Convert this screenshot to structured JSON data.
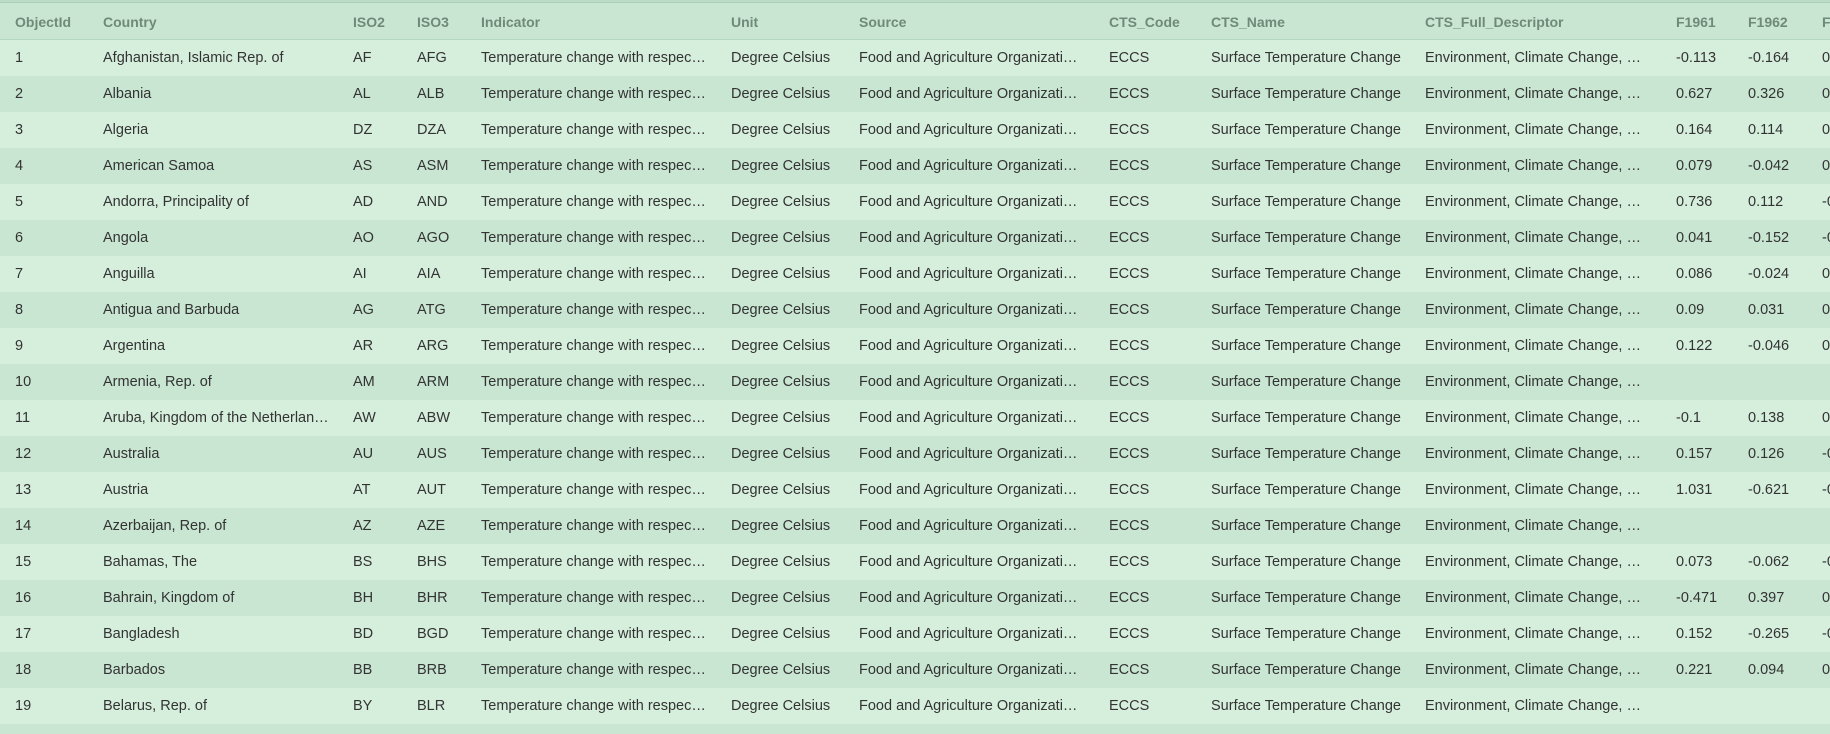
{
  "columns": [
    "ObjectId",
    "Country",
    "ISO2",
    "ISO3",
    "Indicator",
    "Unit",
    "Source",
    "CTS_Code",
    "CTS_Name",
    "CTS_Full_Descriptor",
    "F1961",
    "F1962",
    "F"
  ],
  "rows": [
    [
      "1",
      "Afghanistan, Islamic Rep. of",
      "AF",
      "AFG",
      "Temperature change with respec…",
      "Degree Celsius",
      "Food and Agriculture Organizati…",
      "ECCS",
      "Surface Temperature Change",
      "Environment, Climate Change, …",
      "-0.113",
      "-0.164",
      "0."
    ],
    [
      "2",
      "Albania",
      "AL",
      "ALB",
      "Temperature change with respec…",
      "Degree Celsius",
      "Food and Agriculture Organizati…",
      "ECCS",
      "Surface Temperature Change",
      "Environment, Climate Change, …",
      "0.627",
      "0.326",
      "0."
    ],
    [
      "3",
      "Algeria",
      "DZ",
      "DZA",
      "Temperature change with respec…",
      "Degree Celsius",
      "Food and Agriculture Organizati…",
      "ECCS",
      "Surface Temperature Change",
      "Environment, Climate Change, …",
      "0.164",
      "0.114",
      "0."
    ],
    [
      "4",
      "American Samoa",
      "AS",
      "ASM",
      "Temperature change with respec…",
      "Degree Celsius",
      "Food and Agriculture Organizati…",
      "ECCS",
      "Surface Temperature Change",
      "Environment, Climate Change, …",
      "0.079",
      "-0.042",
      "0."
    ],
    [
      "5",
      "Andorra, Principality of",
      "AD",
      "AND",
      "Temperature change with respec…",
      "Degree Celsius",
      "Food and Agriculture Organizati…",
      "ECCS",
      "Surface Temperature Change",
      "Environment, Climate Change, …",
      "0.736",
      "0.112",
      "-0"
    ],
    [
      "6",
      "Angola",
      "AO",
      "AGO",
      "Temperature change with respec…",
      "Degree Celsius",
      "Food and Agriculture Organizati…",
      "ECCS",
      "Surface Temperature Change",
      "Environment, Climate Change, …",
      "0.041",
      "-0.152",
      "-0"
    ],
    [
      "7",
      "Anguilla",
      "AI",
      "AIA",
      "Temperature change with respec…",
      "Degree Celsius",
      "Food and Agriculture Organizati…",
      "ECCS",
      "Surface Temperature Change",
      "Environment, Climate Change, …",
      "0.086",
      "-0.024",
      "0."
    ],
    [
      "8",
      "Antigua and Barbuda",
      "AG",
      "ATG",
      "Temperature change with respec…",
      "Degree Celsius",
      "Food and Agriculture Organizati…",
      "ECCS",
      "Surface Temperature Change",
      "Environment, Climate Change, …",
      "0.09",
      "0.031",
      "0."
    ],
    [
      "9",
      "Argentina",
      "AR",
      "ARG",
      "Temperature change with respec…",
      "Degree Celsius",
      "Food and Agriculture Organizati…",
      "ECCS",
      "Surface Temperature Change",
      "Environment, Climate Change, …",
      "0.122",
      "-0.046",
      "0."
    ],
    [
      "10",
      "Armenia, Rep. of",
      "AM",
      "ARM",
      "Temperature change with respec…",
      "Degree Celsius",
      "Food and Agriculture Organizati…",
      "ECCS",
      "Surface Temperature Change",
      "Environment, Climate Change, …",
      "",
      "",
      ""
    ],
    [
      "11",
      "Aruba, Kingdom of the Netherlan…",
      "AW",
      "ABW",
      "Temperature change with respec…",
      "Degree Celsius",
      "Food and Agriculture Organizati…",
      "ECCS",
      "Surface Temperature Change",
      "Environment, Climate Change, …",
      "-0.1",
      "0.138",
      "0."
    ],
    [
      "12",
      "Australia",
      "AU",
      "AUS",
      "Temperature change with respec…",
      "Degree Celsius",
      "Food and Agriculture Organizati…",
      "ECCS",
      "Surface Temperature Change",
      "Environment, Climate Change, …",
      "0.157",
      "0.126",
      "-0"
    ],
    [
      "13",
      "Austria",
      "AT",
      "AUT",
      "Temperature change with respec…",
      "Degree Celsius",
      "Food and Agriculture Organizati…",
      "ECCS",
      "Surface Temperature Change",
      "Environment, Climate Change, …",
      "1.031",
      "-0.621",
      "-0"
    ],
    [
      "14",
      "Azerbaijan, Rep. of",
      "AZ",
      "AZE",
      "Temperature change with respec…",
      "Degree Celsius",
      "Food and Agriculture Organizati…",
      "ECCS",
      "Surface Temperature Change",
      "Environment, Climate Change, …",
      "",
      "",
      ""
    ],
    [
      "15",
      "Bahamas, The",
      "BS",
      "BHS",
      "Temperature change with respec…",
      "Degree Celsius",
      "Food and Agriculture Organizati…",
      "ECCS",
      "Surface Temperature Change",
      "Environment, Climate Change, …",
      "0.073",
      "-0.062",
      "-0"
    ],
    [
      "16",
      "Bahrain, Kingdom of",
      "BH",
      "BHR",
      "Temperature change with respec…",
      "Degree Celsius",
      "Food and Agriculture Organizati…",
      "ECCS",
      "Surface Temperature Change",
      "Environment, Climate Change, …",
      "-0.471",
      "0.397",
      "0."
    ],
    [
      "17",
      "Bangladesh",
      "BD",
      "BGD",
      "Temperature change with respec…",
      "Degree Celsius",
      "Food and Agriculture Organizati…",
      "ECCS",
      "Surface Temperature Change",
      "Environment, Climate Change, …",
      "0.152",
      "-0.265",
      "-0"
    ],
    [
      "18",
      "Barbados",
      "BB",
      "BRB",
      "Temperature change with respec…",
      "Degree Celsius",
      "Food and Agriculture Organizati…",
      "ECCS",
      "Surface Temperature Change",
      "Environment, Climate Change, …",
      "0.221",
      "0.094",
      "0."
    ],
    [
      "19",
      "Belarus, Rep. of",
      "BY",
      "BLR",
      "Temperature change with respec…",
      "Degree Celsius",
      "Food and Agriculture Organizati…",
      "ECCS",
      "Surface Temperature Change",
      "Environment, Climate Change, …",
      "",
      "",
      ""
    ]
  ]
}
